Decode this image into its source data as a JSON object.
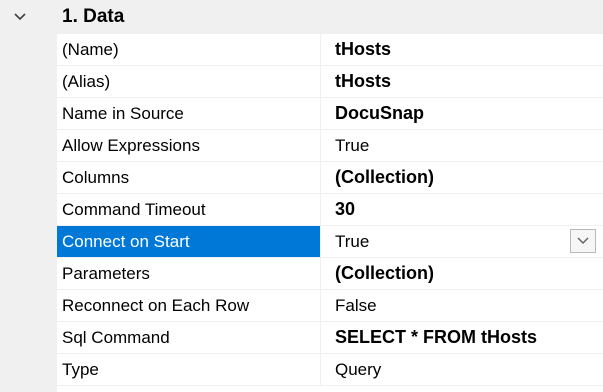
{
  "category": {
    "label": "1. Data",
    "expanded_icon": "chevron-down-icon"
  },
  "properties": [
    {
      "name": "(Name)",
      "value": "tHosts",
      "bold": true
    },
    {
      "name": "(Alias)",
      "value": "tHosts",
      "bold": true
    },
    {
      "name": "Name in Source",
      "value": "DocuSnap",
      "bold": true
    },
    {
      "name": "Allow Expressions",
      "value": "True",
      "bold": false
    },
    {
      "name": "Columns",
      "value": "(Collection)",
      "bold": true
    },
    {
      "name": "Command Timeout",
      "value": "30",
      "bold": true
    },
    {
      "name": "Connect on Start",
      "value": "True",
      "bold": false,
      "selected": true,
      "dropdown": true
    },
    {
      "name": "Parameters",
      "value": "(Collection)",
      "bold": true
    },
    {
      "name": "Reconnect on Each Row",
      "value": "False",
      "bold": false
    },
    {
      "name": "Sql Command",
      "value": "SELECT * FROM tHosts",
      "bold": true
    },
    {
      "name": "Type",
      "value": "Query",
      "bold": false
    }
  ],
  "colors": {
    "selection": "#0078d7",
    "category_background": "#f0f0f0",
    "grid_line": "#f0f0f0"
  }
}
